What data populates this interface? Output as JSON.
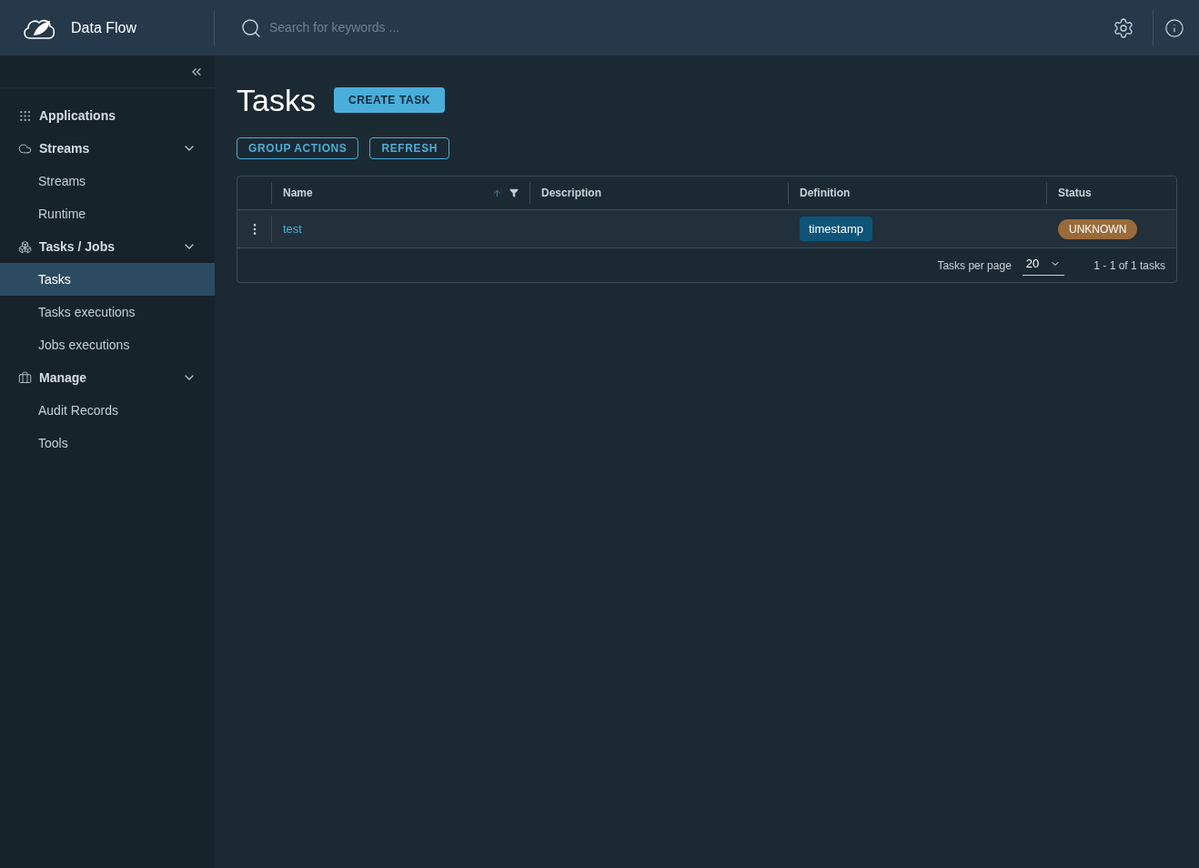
{
  "header": {
    "title": "Data Flow",
    "search": {
      "placeholder": "Search for keywords ..."
    }
  },
  "sidebar": {
    "items": [
      {
        "label": "Applications",
        "kind": "link",
        "selected": false
      },
      {
        "label": "Streams",
        "kind": "group",
        "expanded": true,
        "children": [
          {
            "label": "Streams",
            "selected": false
          },
          {
            "label": "Runtime",
            "selected": false
          }
        ]
      },
      {
        "label": "Tasks / Jobs",
        "kind": "group",
        "expanded": true,
        "children": [
          {
            "label": "Tasks",
            "selected": true
          },
          {
            "label": "Tasks executions",
            "selected": false
          },
          {
            "label": "Jobs executions",
            "selected": false
          }
        ]
      },
      {
        "label": "Manage",
        "kind": "group",
        "expanded": true,
        "children": [
          {
            "label": "Audit Records",
            "selected": false
          },
          {
            "label": "Tools",
            "selected": false
          }
        ]
      }
    ]
  },
  "page": {
    "title": "Tasks",
    "primary_action": "CREATE TASK",
    "actions": [
      "GROUP ACTIONS",
      "REFRESH"
    ]
  },
  "table": {
    "columns": [
      {
        "label": "Name"
      },
      {
        "label": "Description"
      },
      {
        "label": "Definition"
      },
      {
        "label": "Status"
      }
    ],
    "rows": [
      {
        "name": "test",
        "definition": "timestamp",
        "status": "UNKNOWN",
        "color": "#9a6b3a"
      }
    ],
    "footer": {
      "per_page_label": "Tasks per page",
      "per_page": "20",
      "range": "1 - 1 of 1 tasks"
    }
  }
}
